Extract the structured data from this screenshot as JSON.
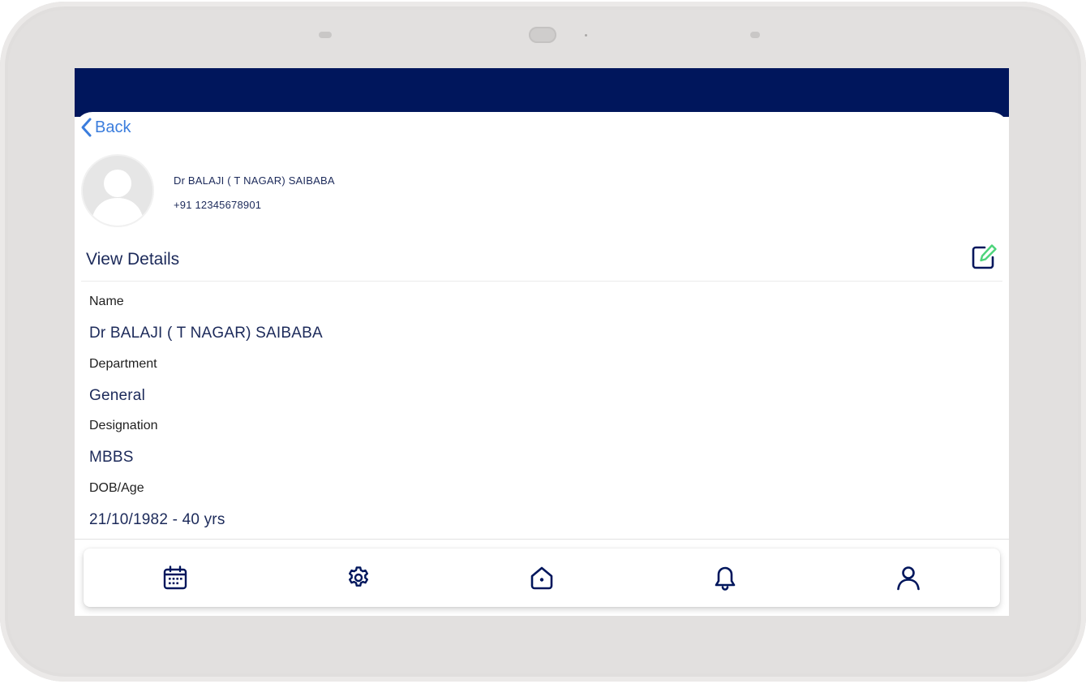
{
  "header": {
    "back_label": "Back"
  },
  "profile": {
    "name": "Dr BALAJI ( T NAGAR) SAIBABA",
    "phone": "+91 12345678901"
  },
  "details": {
    "title": "View Details",
    "fields": [
      {
        "label": "Name",
        "value": "Dr BALAJI ( T NAGAR) SAIBABA"
      },
      {
        "label": "Department",
        "value": "General"
      },
      {
        "label": "Designation",
        "value": "MBBS"
      },
      {
        "label": "DOB/Age",
        "value": "21/10/1982 - 40 yrs"
      }
    ]
  },
  "nav": {
    "items": [
      {
        "icon": "calendar-icon"
      },
      {
        "icon": "gear-icon"
      },
      {
        "icon": "home-icon"
      },
      {
        "icon": "bell-icon"
      },
      {
        "icon": "user-icon"
      }
    ]
  },
  "colors": {
    "header_bg": "#00165c",
    "accent_link": "#3b7ddd",
    "text_primary": "#1c2a5a",
    "edit_accent": "#4cd47a"
  }
}
